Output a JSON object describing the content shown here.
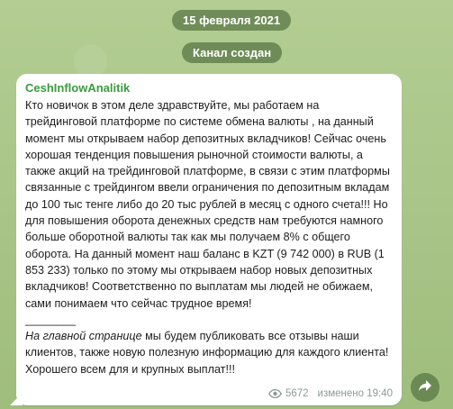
{
  "service": {
    "date": "15 февраля 2021",
    "channel_created": "Канал создан"
  },
  "message": {
    "sender": "CeshInflowAnalitik",
    "paragraph1": "Кто новичок в этом деле здравствуйте, мы работаем на трейдинговой платформе по системе обмена валюты , на данный момент мы открываем набор депозитных вкладчиков! Сейчас очень хорошая тенденция повышения рыночной стоимости валюты, а также акций на трейдинговой платформе, в связи с этим платформы  связанные с трейдингом ввели ограничения по депозитным вкладам до 100 тыс тенге либо до 20 тыс рублей в месяц с одного счета!!! Но для повышения оборота денежных средств нам требуются намного больше оборотной валюты так как мы получаем  8% с общего оборота. На данный момент наш баланс в KZT (9 742 000) в RUB (1 853 233) только по этому мы открываем набор новых депозитных вкладчиков! Соответственно по выплатам мы людей не обижаем, сами понимаем что сейчас трудное время!",
    "separator": "________",
    "italic_link": "На главной странице",
    "paragraph2_rest": " мы будем публиковать все отзывы наши клиентов, также новую полезную информацию для каждого клиента! Хорошего всем для и крупных выплат!!!",
    "views": "5672",
    "edited_time": "изменено 19:40"
  },
  "icons": {
    "views": "eye-icon",
    "share": "share-arrow-icon"
  },
  "colors": {
    "background": "#a9c58a",
    "sender_name": "#3a9b3f",
    "bubble": "#ffffff",
    "meta": "#8e9a93"
  }
}
